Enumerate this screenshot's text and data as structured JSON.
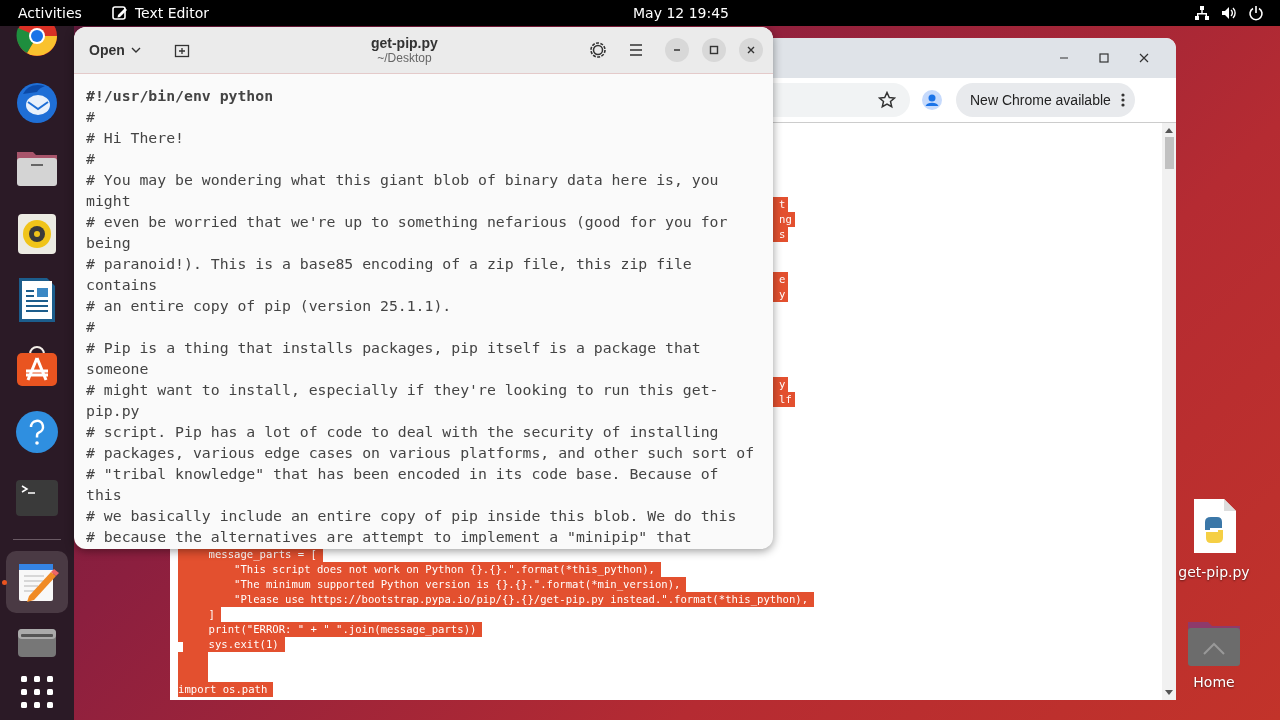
{
  "top_bar": {
    "activities": "Activities",
    "app_name": "Text Editor",
    "clock": "May 12  19:45"
  },
  "dock": {
    "items": [
      {
        "kind": "browser"
      },
      {
        "kind": "mail"
      },
      {
        "kind": "files"
      },
      {
        "kind": "music"
      },
      {
        "kind": "writer"
      },
      {
        "kind": "store"
      },
      {
        "kind": "help"
      },
      {
        "kind": "terminal"
      },
      {
        "kind": "separator"
      },
      {
        "kind": "editor"
      },
      {
        "kind": "disk"
      },
      {
        "kind": "apps"
      }
    ]
  },
  "browser": {
    "update_badge": "New Chrome available",
    "fragments": [
      [
        "t",
        "ng",
        "s"
      ],
      [
        "e",
        "y"
      ],
      [
        "y",
        "lf"
      ]
    ],
    "code_lines": [
      "    message_parts = [",
      "        \"This script does not work on Python {}.{}.\".format(*this_python),",
      "        \"The minimum supported Python version is {}.{}.\".format(*min_version),",
      "        \"Please use https://bootstrap.pypa.io/pip/{}.{}/get-pip.py instead.\".format(*this_python),",
      "    ]",
      "    print(\"ERROR: \" + \" \".join(message_parts))",
      "    sys.exit(1)"
    ],
    "last_line": "import os.path"
  },
  "editor": {
    "open_button": "Open",
    "title": "get-pip.py",
    "subtitle": "~/Desktop",
    "lines": [
      "#!/usr/bin/env python",
      "#",
      "# Hi There!",
      "#",
      "# You may be wondering what this giant blob of binary data here is, you",
      "might",
      "# even be worried that we're up to something nefarious (good for you for",
      "being",
      "# paranoid!). This is a base85 encoding of a zip file, this zip file",
      "contains",
      "# an entire copy of pip (version 25.1.1).",
      "#",
      "# Pip is a thing that installs packages, pip itself is a package that",
      "someone",
      "# might want to install, especially if they're looking to run this get-",
      "pip.py",
      "# script. Pip has a lot of code to deal with the security of installing",
      "# packages, various edge cases on various platforms, and other such sort of",
      "# \"tribal knowledge\" that has been encoded in its code base. Because of",
      "this",
      "# we basically include an entire copy of pip inside this blob. We do this",
      "# because the alternatives are attempt to implement a \"minipip\" that"
    ]
  },
  "desktop_icons": [
    {
      "kind": "python-file",
      "label": "get-pip.py"
    },
    {
      "kind": "folder",
      "label": "Home"
    }
  ]
}
